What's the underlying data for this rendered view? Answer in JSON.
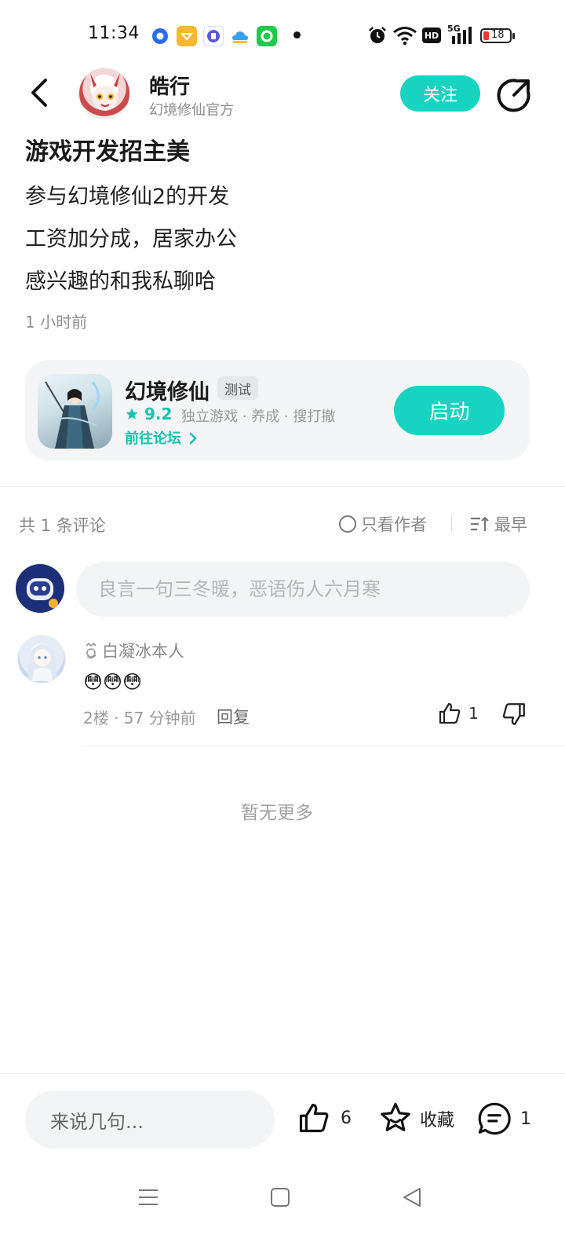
{
  "status_bar": {
    "time": "11:34",
    "battery": "18",
    "network": "5G",
    "hd_label": "HD",
    "app_icons": [
      "blue-circle-app-icon",
      "yellow-diamond-app-icon",
      "tie-app-icon",
      "cloud-app-icon",
      "green-ring-app-icon"
    ]
  },
  "header": {
    "author_name": "皓行",
    "author_subtitle": "幻境修仙官方",
    "follow_label": "关注"
  },
  "post": {
    "title": "游戏开发招主美",
    "lines": [
      "参与幻境修仙2的开发",
      "工资加分成，居家办公",
      "感兴趣的和我私聊哈"
    ],
    "time": "1 小时前"
  },
  "game_card": {
    "name": "幻境修仙",
    "tag": "测试",
    "rating": "9.2",
    "genres": "独立游戏 · 养成 · 搜打撤",
    "forum_link": "前往论坛",
    "launch_label": "启动"
  },
  "comments": {
    "count_label": "共 1 条评论",
    "author_only_label": "只看作者",
    "sort_label": "最早",
    "input_placeholder": "良言一句三冬暖，恶语伤人六月寒",
    "items": [
      {
        "user": "白凝冰本人",
        "content": "😳😳😳",
        "meta": "2楼 · 57 分钟前",
        "reply_label": "回复",
        "likes": "1"
      }
    ],
    "no_more": "暂无更多"
  },
  "bottom_bar": {
    "input_placeholder": "来说几句...",
    "like_count": "6",
    "favorite_label": "收藏",
    "comment_count": "1"
  },
  "colors": {
    "accent": "#19d3c1",
    "accent_text": "#16c2b0",
    "battery_low": "#e53935"
  }
}
